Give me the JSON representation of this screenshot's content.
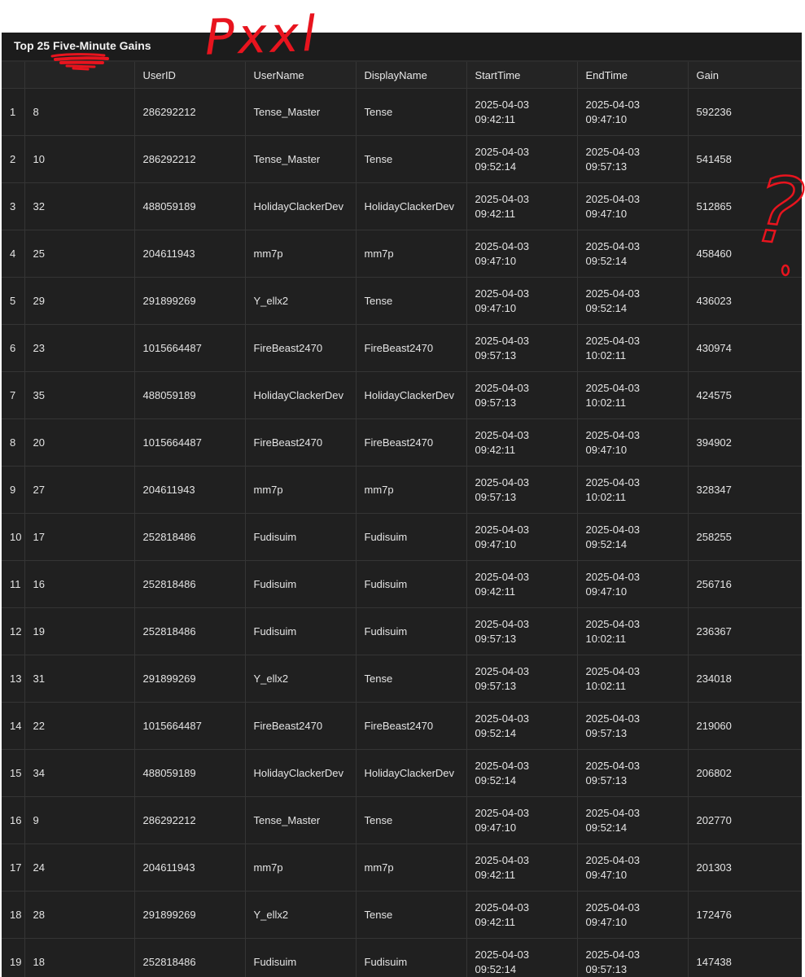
{
  "panel": {
    "title": "Top 25 Five-Minute Gains"
  },
  "table": {
    "columns": [
      "",
      "",
      "UserID",
      "UserName",
      "DisplayName",
      "StartTime",
      "EndTime",
      "Gain"
    ],
    "rows": [
      {
        "index": "1",
        "id": "8",
        "user_id": "286292212",
        "user_name": "Tense_Master",
        "display_name": "Tense",
        "start_date": "2025-04-03",
        "start_time": "09:42:11",
        "end_date": "2025-04-03",
        "end_time": "09:47:10",
        "gain": "592236"
      },
      {
        "index": "2",
        "id": "10",
        "user_id": "286292212",
        "user_name": "Tense_Master",
        "display_name": "Tense",
        "start_date": "2025-04-03",
        "start_time": "09:52:14",
        "end_date": "2025-04-03",
        "end_time": "09:57:13",
        "gain": "541458"
      },
      {
        "index": "3",
        "id": "32",
        "user_id": "488059189",
        "user_name": "HolidayClackerDev",
        "display_name": "HolidayClackerDev",
        "start_date": "2025-04-03",
        "start_time": "09:42:11",
        "end_date": "2025-04-03",
        "end_time": "09:47:10",
        "gain": "512865"
      },
      {
        "index": "4",
        "id": "25",
        "user_id": "204611943",
        "user_name": "mm7p",
        "display_name": "mm7p",
        "start_date": "2025-04-03",
        "start_time": "09:47:10",
        "end_date": "2025-04-03",
        "end_time": "09:52:14",
        "gain": "458460"
      },
      {
        "index": "5",
        "id": "29",
        "user_id": "291899269",
        "user_name": "Y_ellx2",
        "display_name": "Tense",
        "start_date": "2025-04-03",
        "start_time": "09:47:10",
        "end_date": "2025-04-03",
        "end_time": "09:52:14",
        "gain": "436023"
      },
      {
        "index": "6",
        "id": "23",
        "user_id": "1015664487",
        "user_name": "FireBeast2470",
        "display_name": "FireBeast2470",
        "start_date": "2025-04-03",
        "start_time": "09:57:13",
        "end_date": "2025-04-03",
        "end_time": "10:02:11",
        "gain": "430974"
      },
      {
        "index": "7",
        "id": "35",
        "user_id": "488059189",
        "user_name": "HolidayClackerDev",
        "display_name": "HolidayClackerDev",
        "start_date": "2025-04-03",
        "start_time": "09:57:13",
        "end_date": "2025-04-03",
        "end_time": "10:02:11",
        "gain": "424575"
      },
      {
        "index": "8",
        "id": "20",
        "user_id": "1015664487",
        "user_name": "FireBeast2470",
        "display_name": "FireBeast2470",
        "start_date": "2025-04-03",
        "start_time": "09:42:11",
        "end_date": "2025-04-03",
        "end_time": "09:47:10",
        "gain": "394902"
      },
      {
        "index": "9",
        "id": "27",
        "user_id": "204611943",
        "user_name": "mm7p",
        "display_name": "mm7p",
        "start_date": "2025-04-03",
        "start_time": "09:57:13",
        "end_date": "2025-04-03",
        "end_time": "10:02:11",
        "gain": "328347"
      },
      {
        "index": "10",
        "id": "17",
        "user_id": "252818486",
        "user_name": "Fudisuim",
        "display_name": "Fudisuim",
        "start_date": "2025-04-03",
        "start_time": "09:47:10",
        "end_date": "2025-04-03",
        "end_time": "09:52:14",
        "gain": "258255"
      },
      {
        "index": "11",
        "id": "16",
        "user_id": "252818486",
        "user_name": "Fudisuim",
        "display_name": "Fudisuim",
        "start_date": "2025-04-03",
        "start_time": "09:42:11",
        "end_date": "2025-04-03",
        "end_time": "09:47:10",
        "gain": "256716"
      },
      {
        "index": "12",
        "id": "19",
        "user_id": "252818486",
        "user_name": "Fudisuim",
        "display_name": "Fudisuim",
        "start_date": "2025-04-03",
        "start_time": "09:57:13",
        "end_date": "2025-04-03",
        "end_time": "10:02:11",
        "gain": "236367"
      },
      {
        "index": "13",
        "id": "31",
        "user_id": "291899269",
        "user_name": "Y_ellx2",
        "display_name": "Tense",
        "start_date": "2025-04-03",
        "start_time": "09:57:13",
        "end_date": "2025-04-03",
        "end_time": "10:02:11",
        "gain": "234018"
      },
      {
        "index": "14",
        "id": "22",
        "user_id": "1015664487",
        "user_name": "FireBeast2470",
        "display_name": "FireBeast2470",
        "start_date": "2025-04-03",
        "start_time": "09:52:14",
        "end_date": "2025-04-03",
        "end_time": "09:57:13",
        "gain": "219060"
      },
      {
        "index": "15",
        "id": "34",
        "user_id": "488059189",
        "user_name": "HolidayClackerDev",
        "display_name": "HolidayClackerDev",
        "start_date": "2025-04-03",
        "start_time": "09:52:14",
        "end_date": "2025-04-03",
        "end_time": "09:57:13",
        "gain": "206802"
      },
      {
        "index": "16",
        "id": "9",
        "user_id": "286292212",
        "user_name": "Tense_Master",
        "display_name": "Tense",
        "start_date": "2025-04-03",
        "start_time": "09:47:10",
        "end_date": "2025-04-03",
        "end_time": "09:52:14",
        "gain": "202770"
      },
      {
        "index": "17",
        "id": "24",
        "user_id": "204611943",
        "user_name": "mm7p",
        "display_name": "mm7p",
        "start_date": "2025-04-03",
        "start_time": "09:42:11",
        "end_date": "2025-04-03",
        "end_time": "09:47:10",
        "gain": "201303"
      },
      {
        "index": "18",
        "id": "28",
        "user_id": "291899269",
        "user_name": "Y_ellx2",
        "display_name": "Tense",
        "start_date": "2025-04-03",
        "start_time": "09:42:11",
        "end_date": "2025-04-03",
        "end_time": "09:47:10",
        "gain": "172476"
      },
      {
        "index": "19",
        "id": "18",
        "user_id": "252818486",
        "user_name": "Fudisuim",
        "display_name": "Fudisuim",
        "start_date": "2025-04-03",
        "start_time": "09:52:14",
        "end_date": "2025-04-03",
        "end_time": "09:57:13",
        "gain": "147438"
      }
    ]
  },
  "annotations": {
    "handwritten_text": "Pxxl",
    "question_mark": "?",
    "ink_color": "#e8141e"
  },
  "colors": {
    "panel_background": "#1f1f1f",
    "grid_lines": "#353535",
    "text": "#e4e4e4"
  }
}
